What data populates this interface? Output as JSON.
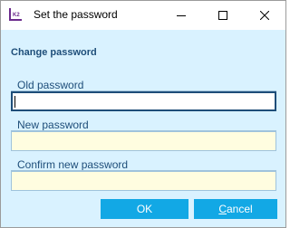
{
  "window": {
    "title": "Set the password",
    "app_icon": "k2-app-icon",
    "controls": [
      "minimize-icon",
      "maximize-icon",
      "close-icon"
    ]
  },
  "section": {
    "title": "Change password"
  },
  "fields": [
    {
      "label": "Old password",
      "value": "",
      "focused": true
    },
    {
      "label": "New password",
      "value": ""
    },
    {
      "label": "Confirm new password",
      "value": ""
    }
  ],
  "buttons": {
    "ok": "OK",
    "cancel_mnemonic": "C",
    "cancel_rest": "ancel"
  },
  "colors": {
    "dialog_bg": "#d9f2ff",
    "accent_text": "#1e4e79",
    "button_bg": "#12a8e5",
    "input_bg": "#fffde0"
  }
}
